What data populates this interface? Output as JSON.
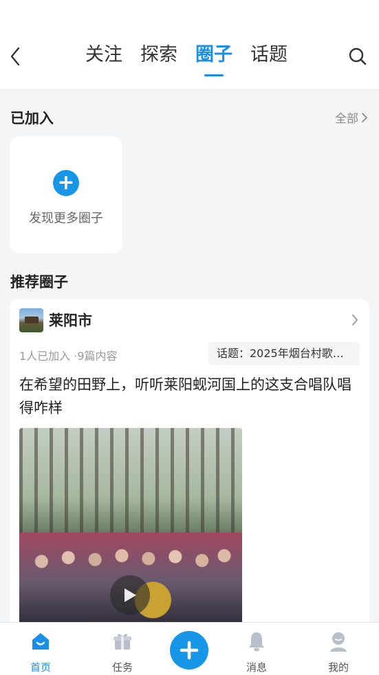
{
  "header": {
    "tabs": [
      {
        "label": "关注"
      },
      {
        "label": "探索"
      },
      {
        "label": "圈子"
      },
      {
        "label": "话题"
      }
    ],
    "active_tab_index": 2
  },
  "joined": {
    "title": "已加入",
    "see_all": "全部",
    "discover_label": "发现更多圈子"
  },
  "recommended": {
    "title": "推荐圈子",
    "circle": {
      "name": "莱阳市",
      "meta": "1人已加入 ·9篇内容",
      "topic": "话题：2025年烟台村歌…",
      "post_title": "在希望的田野上，听听莱阳蚬河国上的这支合唱队唱得咋样"
    }
  },
  "bottom_nav": {
    "items": [
      {
        "label": "首页",
        "icon": "home-icon"
      },
      {
        "label": "任务",
        "icon": "gift-icon"
      },
      {
        "label": "消息",
        "icon": "bell-icon"
      },
      {
        "label": "我的",
        "icon": "profile-icon"
      }
    ],
    "active_index": 0
  },
  "colors": {
    "accent": "#1a8fe6",
    "fab": "#1796e8",
    "background": "#f4f5f7"
  }
}
